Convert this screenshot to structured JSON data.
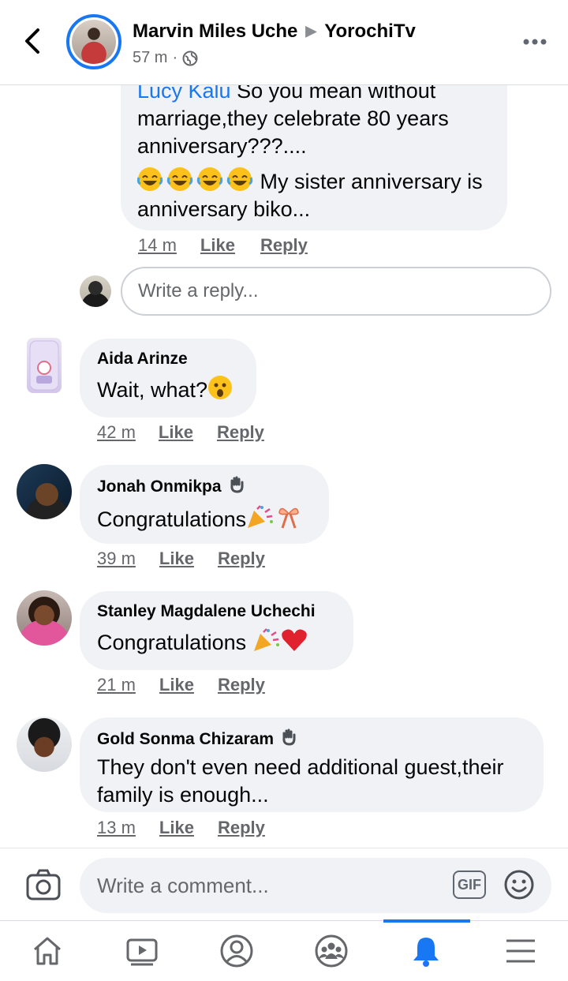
{
  "header": {
    "author": "Marvin Miles Uche",
    "page": "YorochiTv",
    "time": "57 m",
    "separator": "·"
  },
  "reply_thread": {
    "mention": "Lucy Kalu",
    "text_1": " So you mean without marriage,they  celebrate 80 years anniversary???....",
    "text_2": "My sister anniversary is anniversary biko...",
    "time": "14 m",
    "like": "Like",
    "reply": "Reply",
    "reply_placeholder": "Write a reply..."
  },
  "comments": [
    {
      "author": "Aida Arinze",
      "text": "Wait, what?",
      "time": "42 m",
      "like": "Like",
      "reply": "Reply"
    },
    {
      "author": "Jonah Onmikpa",
      "text": "Congratulations",
      "time": "39 m",
      "like": "Like",
      "reply": "Reply"
    },
    {
      "author": "Stanley Magdalene Uchechi",
      "text": "Congratulations ",
      "time": "21 m",
      "like": "Like",
      "reply": "Reply"
    },
    {
      "author": "Gold Sonma Chizaram",
      "text": "They don't even need additional guest,their family is enough...",
      "time": "13 m",
      "like": "Like",
      "reply": "Reply"
    }
  ],
  "composer": {
    "placeholder": "Write a comment...",
    "gif_label": "GIF"
  },
  "tabs": {
    "items": [
      "home-icon",
      "watch-icon",
      "profile-icon",
      "groups-icon",
      "notifications-icon",
      "menu-icon"
    ],
    "active": "notifications-icon"
  },
  "colors": {
    "accent": "#1877f2",
    "bubble": "#f0f2f5",
    "muted": "#65676b"
  }
}
